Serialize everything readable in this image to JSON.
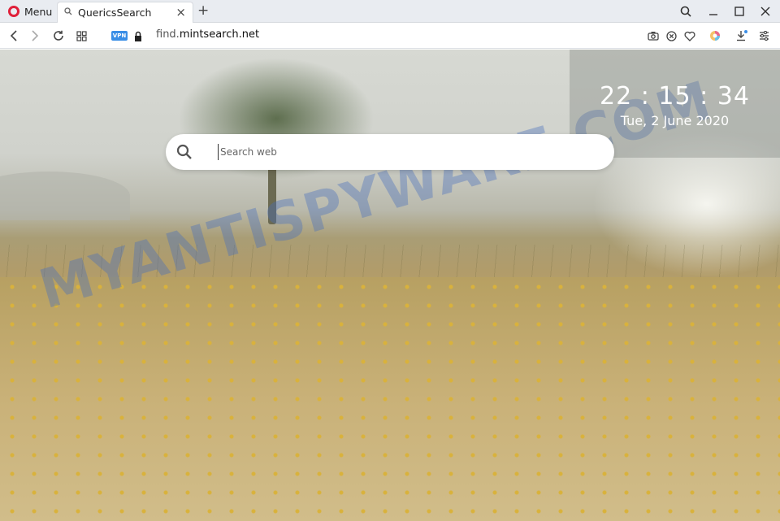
{
  "browser": {
    "menu_label": "Menu",
    "tab": {
      "title": "QuericsSearch",
      "close": "×"
    },
    "new_tab": "+",
    "window_controls": {
      "search": "search-icon",
      "minimize": "—",
      "maximize": "□",
      "close": "✕"
    },
    "address": {
      "vpn_badge": "VPN",
      "url_prefix": "find.",
      "url_domain": "mintsearch.net"
    },
    "toolbar_icons": [
      "camera-icon",
      "close-circle-icon",
      "heart-icon",
      "wallet-icon",
      "download-icon",
      "settings-icon"
    ]
  },
  "page": {
    "clock": {
      "time": "22 : 15 : 34",
      "date": "Tue, 2 June 2020"
    },
    "search": {
      "placeholder": "Search web",
      "value": ""
    },
    "watermark": "MYANTISPYWARE.COM"
  },
  "colors": {
    "accent": "#3a8ee6",
    "opera_red": "#e0203a"
  }
}
